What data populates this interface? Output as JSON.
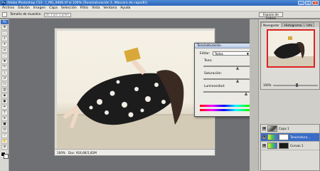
{
  "window": {
    "title": "Adobe Photoshop CS3 - [_MG_9406.tif al 100% (Tono/saturación 1, Máscara de capa/8)]",
    "logo": "Ps",
    "buttons": [
      "_",
      "□",
      "x"
    ]
  },
  "menu": [
    "Archivo",
    "Edición",
    "Imagen",
    "Capa",
    "Selección",
    "Filtro",
    "Vista",
    "Ventana",
    "Ayuda"
  ],
  "options": {
    "size_label": "Tamaño de muestra:",
    "size_value": "De 3 por 3 prom.",
    "workspace": "Espacio de trabajo"
  },
  "toolbox": {
    "logo": "Ps",
    "tools": [
      "move-icon",
      "marquee-icon",
      "lasso-icon",
      "magic-wand-icon",
      "crop-icon",
      "slice-icon",
      "healing-icon",
      "brush-icon",
      "stamp-icon",
      "history-brush-icon",
      "eraser-icon",
      "gradient-icon",
      "blur-icon",
      "dodge-icon",
      "pen-icon",
      "type-icon",
      "path-select-icon",
      "shape-icon",
      "notes-icon",
      "eyedropper-icon",
      "hand-icon",
      "zoom-icon"
    ]
  },
  "document": {
    "status_zoom": "100%",
    "status_doc": "Doc: 924,6K/1,81M"
  },
  "dialog": {
    "title": "Tono/saturación",
    "close": "x",
    "edit_label": "Editar:",
    "edit_value": "Todos",
    "hue_label": "Tono:",
    "hue_value": "0",
    "sat_label": "Saturación:",
    "sat_value": "0",
    "light_label": "Luminosidad:",
    "light_value": "+26",
    "ok": "OK",
    "cancel": "Cancelar",
    "load": "Cargar...",
    "save": "Guardar...",
    "colorize": "Colorear",
    "preview": "Previsualizar",
    "preview_checked": true,
    "colorize_checked": false
  },
  "navigator": {
    "tabs": [
      "Navegador",
      "Histograma",
      "Info"
    ],
    "zoom": "100%"
  },
  "layers": [
    {
      "name": "Capa 1",
      "thumb": "img",
      "selected": false
    },
    {
      "name": "Tono/satura...",
      "thumb": "adj",
      "selected": true
    },
    {
      "name": "Curvas 1",
      "thumb": "adj",
      "selected": false
    }
  ]
}
